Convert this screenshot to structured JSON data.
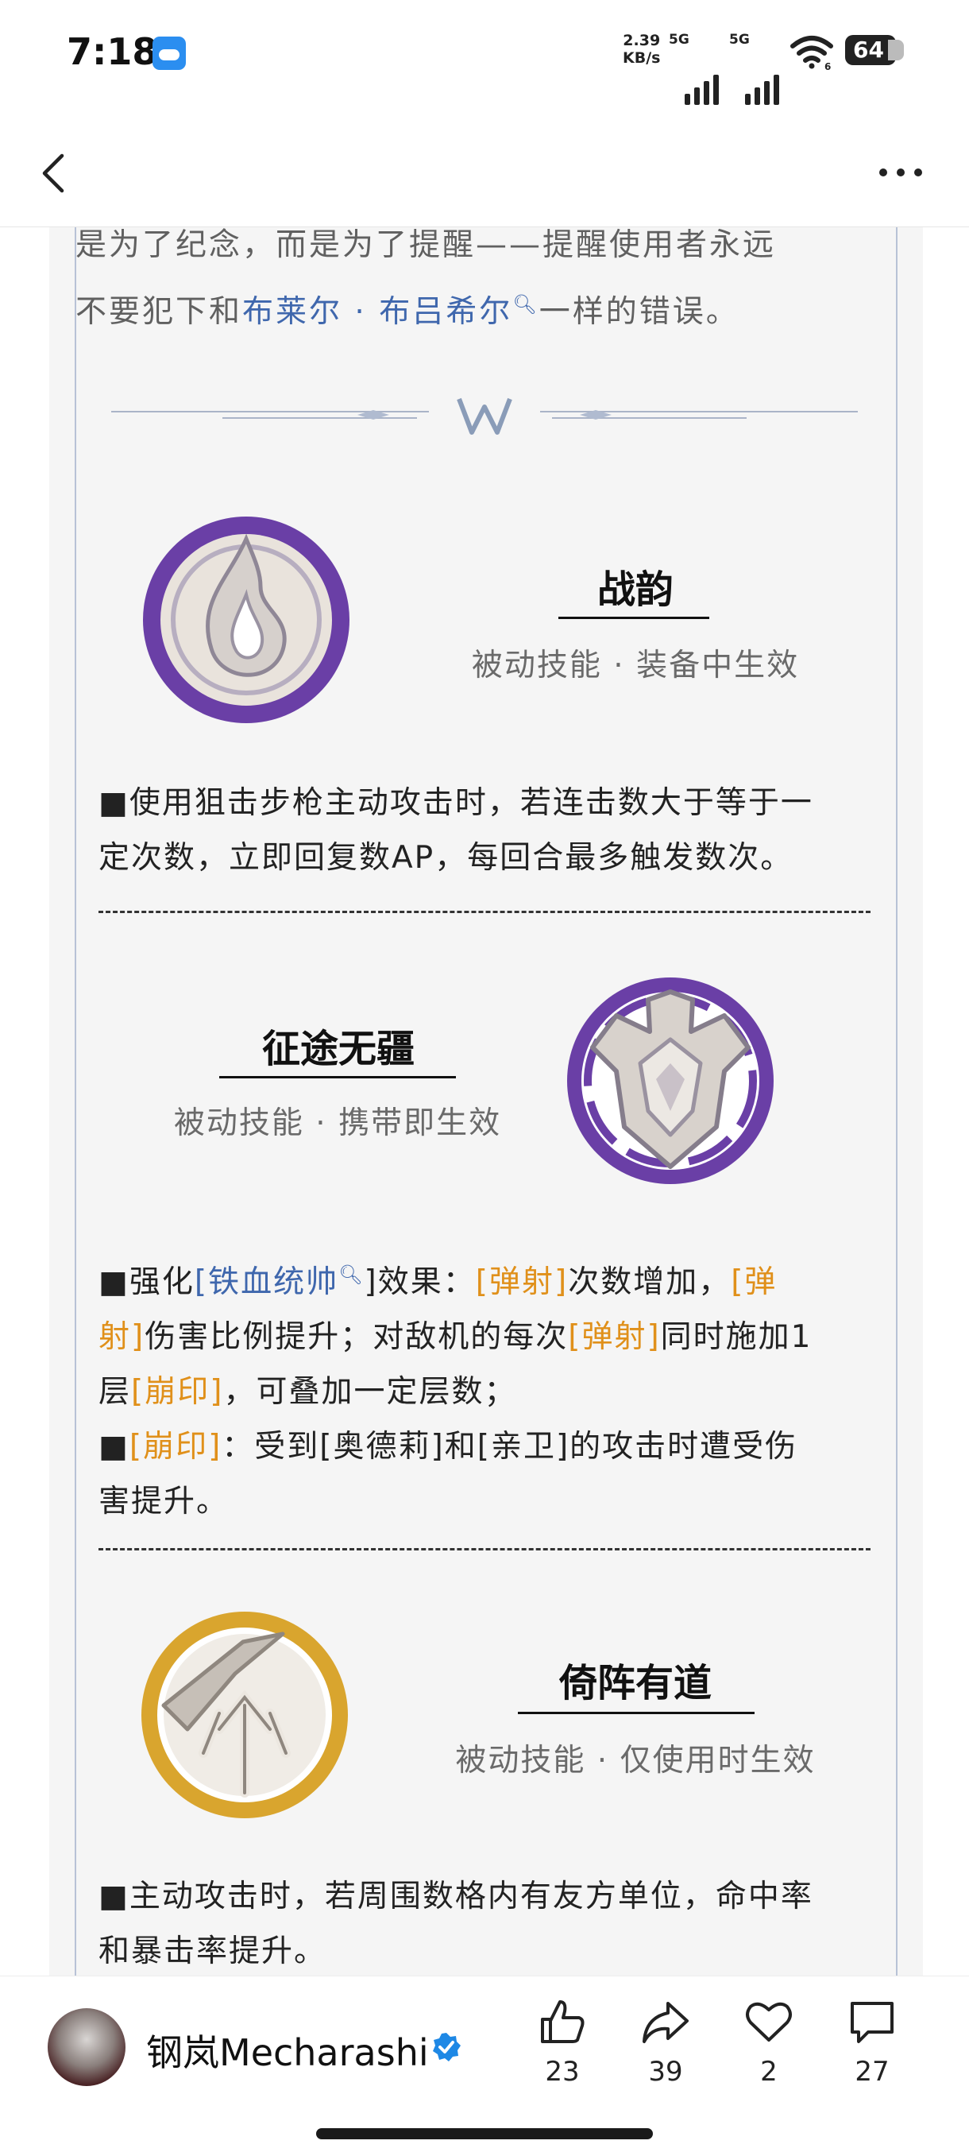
{
  "status_bar": {
    "time": "7:18",
    "net_speed_value": "2.39",
    "net_speed_unit": "KB/s",
    "signal1_label": "5G",
    "signal2_label": "5G",
    "wifi_sub": "6",
    "battery": "64"
  },
  "article": {
    "intro_line1": "是为了纪念，而是为了提醒——提醒使用者永远",
    "intro_pre": "不要犯下和",
    "intro_link": "布莱尔 · 布吕希尔",
    "intro_post": "一样的错误。",
    "skills": [
      {
        "name": "战韵",
        "subtitle": "被动技能 · 装备中生效",
        "icon": "flame-emblem-icon",
        "desc_line1": "■使用狙击步枪主动攻击时，若连击数大于等于一",
        "desc_line2": "定次数，立即回复数AP，每回合最多触发数次。"
      },
      {
        "name": "征途无疆",
        "subtitle": "被动技能 · 携带即生效",
        "icon": "armor-crest-icon",
        "p1_a": "■强化",
        "p1_link": "[铁血统帅",
        "p1_b": "]效果：",
        "p1_kw1": "[弹射]",
        "p1_c": "次数增加，",
        "p1_kw2": "[弹",
        "p2_kw2": "射]",
        "p2_a": "伤害比例提升；对敌机的每次",
        "p2_kw3": "[弹射]",
        "p2_b": "同时施加1",
        "p3_a": "层",
        "p3_kw": "[崩印]",
        "p3_b": "，可叠加一定层数；",
        "p4_sq": "■",
        "p4_kw": "[崩印]",
        "p4_a": "：受到[奥德莉]和[亲卫]的攻击时遭受伤",
        "p5": "害提升。"
      },
      {
        "name": "倚阵有道",
        "subtitle": "被动技能 · 仅使用时生效",
        "icon": "trident-emblem-icon",
        "desc_line1": "■主动攻击时，若周围数格内有友方单位，命中率",
        "desc_line2": "和暴击率提升。"
      }
    ]
  },
  "bottom_bar": {
    "author": "钢岚Mecharashi",
    "likes": "23",
    "shares": "39",
    "favorites": "2",
    "comments": "27"
  },
  "colors": {
    "link": "#3f67ad",
    "keyword": "#e0901a",
    "purple_ring": "#6a3fa6",
    "gold_ring": "#d9a52e"
  }
}
